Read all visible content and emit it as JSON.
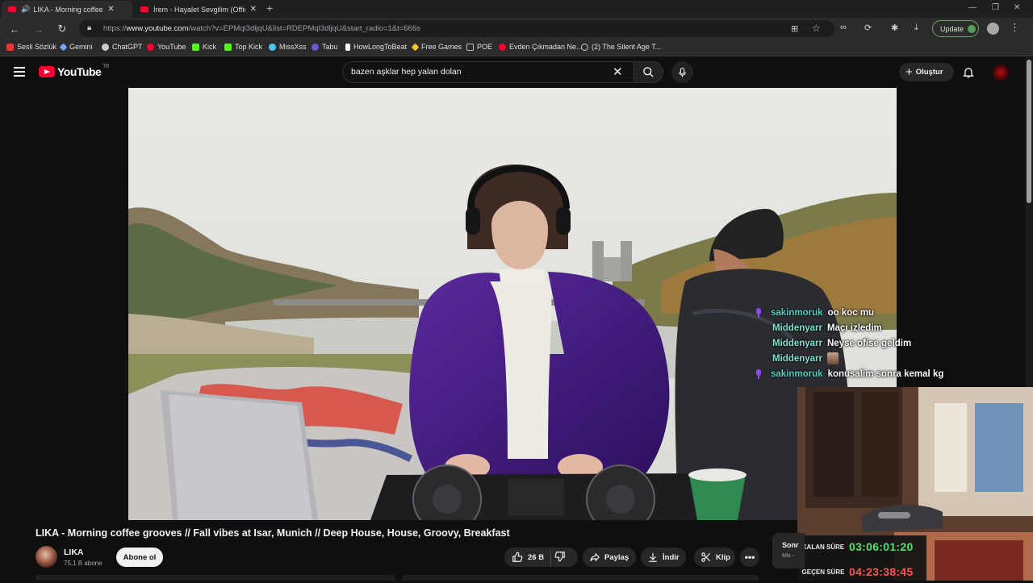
{
  "browser": {
    "tabs": [
      {
        "title": "LIKA - Morning coffee groov",
        "active": true
      },
      {
        "title": "İrem - Hayalet Sevgilim (Official A",
        "active": false
      }
    ],
    "url_prefix": "https://",
    "url_domain": "www.youtube.com",
    "url_rest": "/watch?v=EPMql3dljqU&list=RDEPMql3dljqU&start_radio=1&t=666s",
    "update_label": "Update",
    "bookmarks": [
      {
        "label": "Sesli Sözlük",
        "color": "#e53935"
      },
      {
        "label": "Gemini",
        "color": "#7aa7ff"
      },
      {
        "label": "ChatGPT",
        "color": "#cccccc"
      },
      {
        "label": "YouTube",
        "color": "#ff0033"
      },
      {
        "label": "Kick",
        "color": "#53fc18"
      },
      {
        "label": "Top Kick",
        "color": "#53fc18"
      },
      {
        "label": "MissXss",
        "color": "#4fc3f7"
      },
      {
        "label": "Tabu",
        "color": "#6a5acd"
      },
      {
        "label": "HowLongToBeat",
        "color": "#ffffff"
      },
      {
        "label": "Free Games",
        "color": "#f4c430"
      },
      {
        "label": "POE",
        "color": "#888888"
      },
      {
        "label": "Evden Çıkmadan Ne...",
        "color": "#ff0033"
      },
      {
        "label": "(2) The Silent Age T...",
        "color": "#cccccc"
      }
    ]
  },
  "youtube": {
    "logo_text": "YouTube",
    "country_code": "TR",
    "search": {
      "value": "bazen aşklar hep yalan dolan"
    },
    "create_label": "Oluştur"
  },
  "video": {
    "title": "LIKA - Morning coffee grooves // Fall vibes at Isar, Munich // Deep House, House, Groovy, Breakfast",
    "channel_name": "LIKA",
    "subscribers": "75,1 B abone",
    "subscribe_label": "Abone ol",
    "likes": "26 B",
    "share_label": "Paylaş",
    "download_label": "İndir",
    "clip_label": "Klip",
    "next_card": {
      "title": "Sonr",
      "subtitle": "Mix -"
    }
  },
  "chat": [
    {
      "user": "sakinmoruk",
      "badge": true,
      "message": "oo koc mu",
      "user_color": "#4fd1c5"
    },
    {
      "user": "Middenyarr",
      "badge": false,
      "message": "Maçı izledim",
      "user_color": "#7fe3d0"
    },
    {
      "user": "Middenyarr",
      "badge": false,
      "message": "Neyse ofise geldim",
      "user_color": "#7fe3d0"
    },
    {
      "user": "Middenyarr",
      "badge": false,
      "message": "",
      "emote": true,
      "user_color": "#7fe3d0"
    },
    {
      "user": "sakinmoruk",
      "badge": true,
      "message": "konusalim sonra kemal kg",
      "user_color": "#4fd1c5"
    }
  ],
  "timers": {
    "remaining_label": "KALAN SÜRE",
    "remaining_value": "03:06:01:20",
    "remaining_color": "#4ee36a",
    "elapsed_label": "GEÇEN SÜRE",
    "elapsed_value": "04:23:38:45",
    "elapsed_color": "#ff5252"
  },
  "colors": {
    "youtube_red": "#ff0033",
    "badge_purple": "#9146ff"
  }
}
